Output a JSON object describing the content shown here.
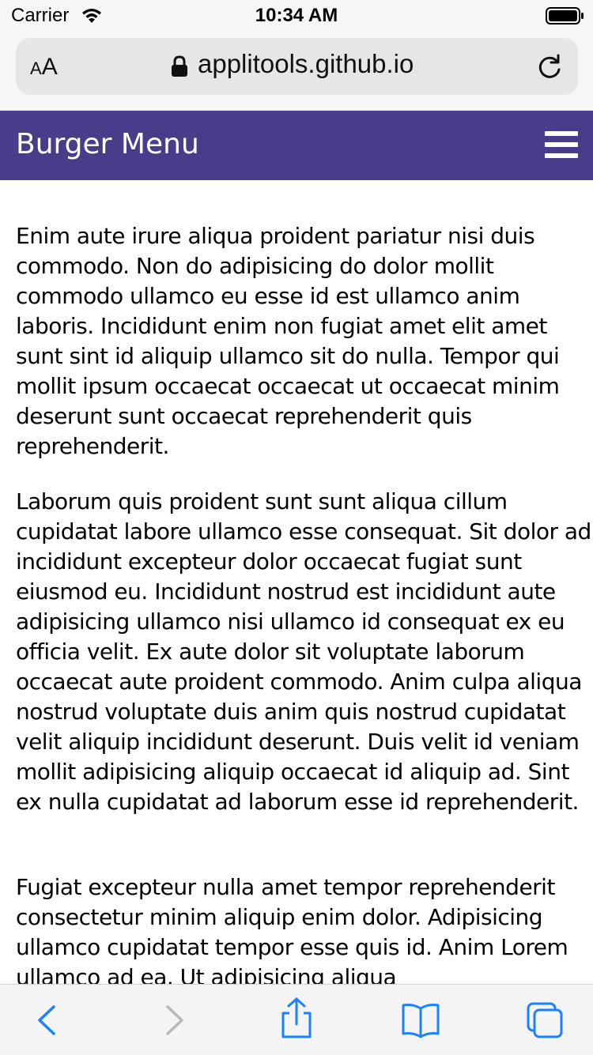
{
  "status_bar": {
    "carrier": "Carrier",
    "time": "10:34 AM"
  },
  "browser": {
    "text_size_label_small": "A",
    "text_size_label_big": "A",
    "domain": "applitools.github.io"
  },
  "page": {
    "nav_title": "Burger Menu",
    "paragraphs": [
      "Enim aute irure aliqua proident pariatur nisi duis commodo. Non do adipisicing do dolor mollit commodo ullamco eu esse id est ullamco anim laboris. Incididunt enim non fugiat amet elit amet sunt sint id aliquip ullamco sit do nulla. Tempor qui mollit ipsum occaecat occaecat ut occaecat minim deserunt sunt occaecat reprehenderit quis reprehenderit.",
      "Laborum quis proident sunt sunt aliqua cillum cupidatat labore ullamco esse consequat. Sit dolor ad incididunt excepteur dolor occaecat fugiat sunt eiusmod eu. Incididunt nostrud est incididunt aute adipisicing ullamco nisi ullamco id consequat ex eu officia velit. Ex aute dolor sit voluptate laborum occaecat aute proident commodo. Anim culpa aliqua nostrud voluptate duis anim quis nostrud cupidatat velit aliquip incididunt deserunt. Duis velit id veniam mollit adipisicing aliquip occaecat id aliquip ad. Sint ex nulla cupidatat ad laborum esse id reprehenderit.",
      "Fugiat excepteur nulla amet tempor reprehenderit consectetur minim aliquip enim dolor. Adipisicing ullamco cupidatat tempor esse quis id. Anim Lorem ullamco ad ea. Ut adipisicing aliqua"
    ]
  },
  "icons": {
    "wifi": "wifi-icon",
    "battery": "battery-icon",
    "lock": "lock-icon",
    "reload": "reload-icon",
    "menu": "hamburger-menu-icon",
    "back": "chevron-left-icon",
    "forward": "chevron-right-icon",
    "share": "share-icon",
    "bookmarks": "book-icon",
    "tabs": "tabs-icon"
  },
  "colors": {
    "nav_background": "#483d8b",
    "toolbar_accent": "#1a82fb"
  }
}
